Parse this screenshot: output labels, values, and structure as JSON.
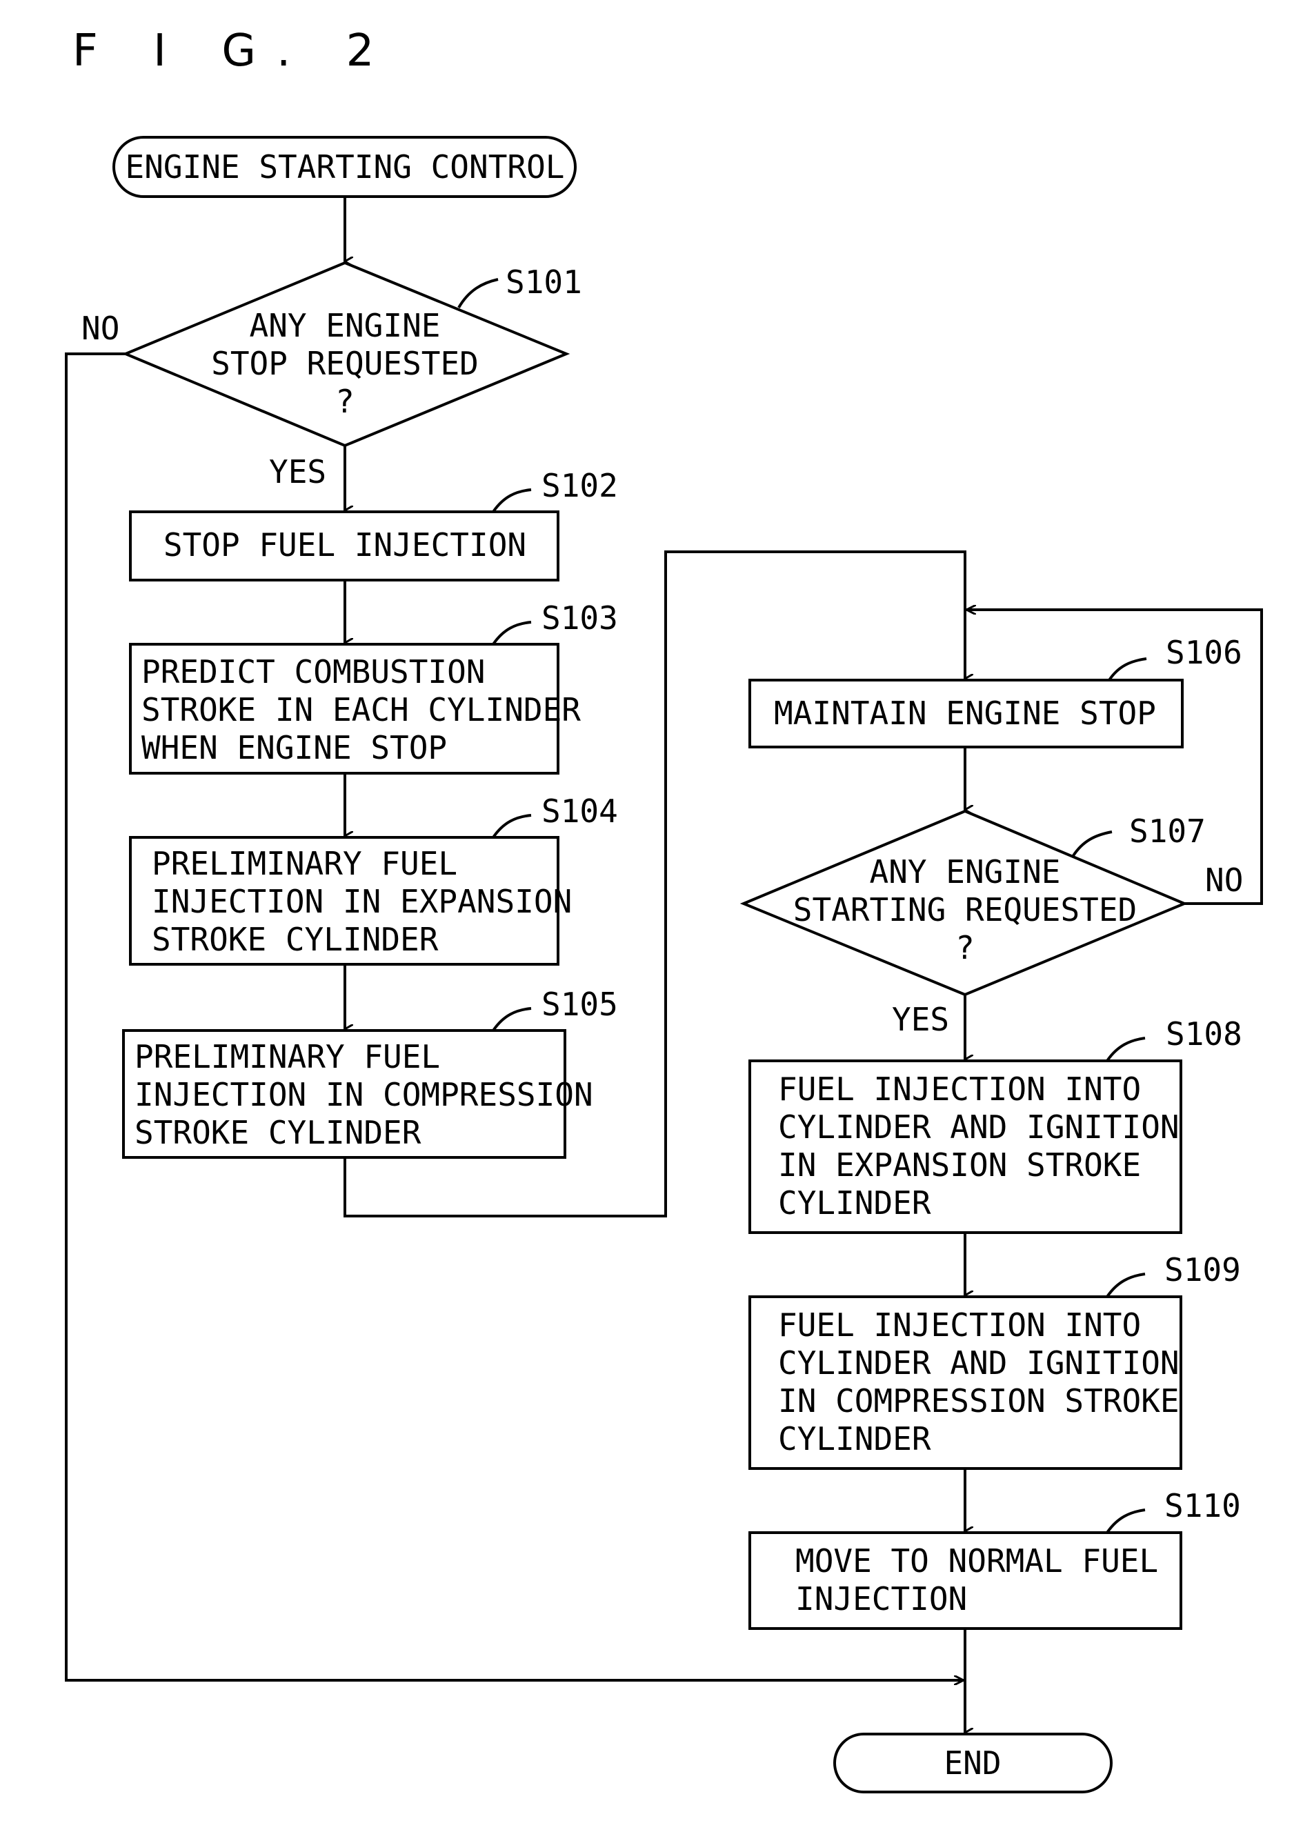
{
  "figure_title": "F I G. 2",
  "start": {
    "label": "ENGINE STARTING CONTROL"
  },
  "end": {
    "label": "END"
  },
  "steps": {
    "s101": {
      "id": "S101",
      "lines": [
        "ANY ENGINE",
        "STOP REQUESTED",
        "?"
      ],
      "yes": "YES",
      "no": "NO"
    },
    "s102": {
      "id": "S102",
      "lines": [
        "STOP FUEL INJECTION"
      ]
    },
    "s103": {
      "id": "S103",
      "lines": [
        "PREDICT COMBUSTION",
        "STROKE IN EACH CYLINDER",
        "WHEN ENGINE STOP"
      ]
    },
    "s104": {
      "id": "S104",
      "lines": [
        "PRELIMINARY FUEL",
        "INJECTION IN EXPANSION",
        "STROKE CYLINDER"
      ]
    },
    "s105": {
      "id": "S105",
      "lines": [
        "PRELIMINARY FUEL",
        "INJECTION IN COMPRESSION",
        "STROKE CYLINDER"
      ]
    },
    "s106": {
      "id": "S106",
      "lines": [
        "MAINTAIN ENGINE STOP"
      ]
    },
    "s107": {
      "id": "S107",
      "lines": [
        "ANY ENGINE",
        "STARTING REQUESTED",
        "?"
      ],
      "yes": "YES",
      "no": "NO"
    },
    "s108": {
      "id": "S108",
      "lines": [
        "FUEL INJECTION INTO",
        "CYLINDER AND IGNITION",
        "IN EXPANSION STROKE",
        "CYLINDER"
      ]
    },
    "s109": {
      "id": "S109",
      "lines": [
        "FUEL INJECTION INTO",
        "CYLINDER AND IGNITION",
        "IN COMPRESSION STROKE",
        "CYLINDER"
      ]
    },
    "s110": {
      "id": "S110",
      "lines": [
        "MOVE TO NORMAL FUEL",
        "INJECTION"
      ]
    }
  }
}
